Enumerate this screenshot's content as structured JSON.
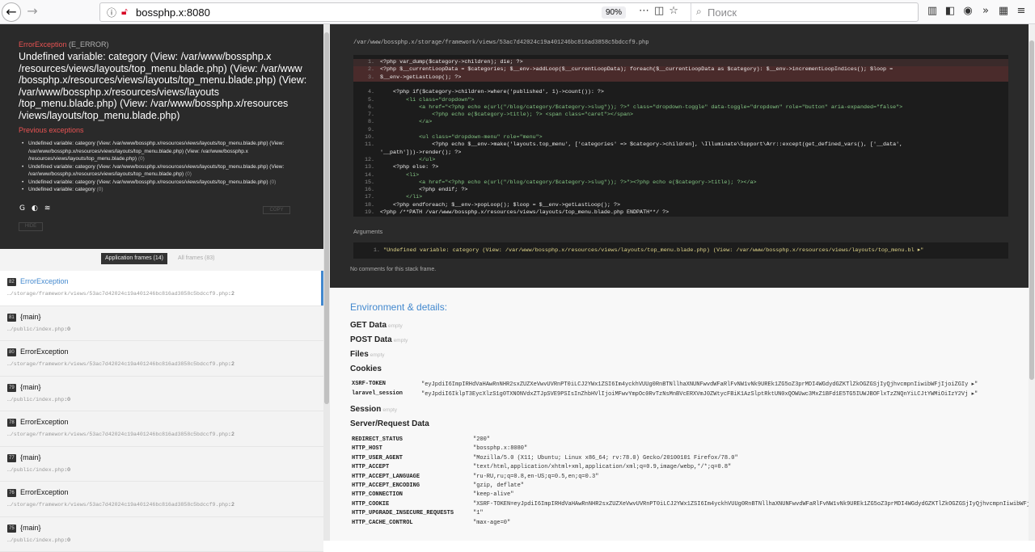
{
  "browser": {
    "url": "bossphp.x:8080",
    "zoom": "90%",
    "search_placeholder": "Поиск"
  },
  "exception": {
    "class": "ErrorException",
    "severity": "(E_ERROR)",
    "message": "Undefined variable: category (View: /var/www/bossphp.x /resources/views/layouts/top_menu.blade.php) (View: /var/www /bossphp.x/resources/views/layouts/top_menu.blade.php) (View: /var/www/bossphp.x/resources/views/layouts /top_menu.blade.php) (View: /var/www/bossphp.x/resources /views/layouts/top_menu.blade.php)",
    "previous_title": "Previous exceptions",
    "previous": [
      {
        "text": "Undefined variable: category (View: /var/www/bossphp.x/resources/views/layouts/top_menu.blade.php) (View: /var/www/bossphp.x/resources/views/layouts/top_menu.blade.php) (View: /var/www/bossphp.x /resources/views/layouts/top_menu.blade.php)",
        "n": "(0)"
      },
      {
        "text": "Undefined variable: category (View: /var/www/bossphp.x/resources/views/layouts/top_menu.blade.php) (View: /var/www/bossphp.x/resources/views/layouts/top_menu.blade.php)",
        "n": "(0)"
      },
      {
        "text": "Undefined variable: category (View: /var/www/bossphp.x/resources/views/layouts/top_menu.blade.php)",
        "n": "(0)"
      },
      {
        "text": "Undefined variable: category",
        "n": "(0)"
      }
    ],
    "copy_label": "COPY",
    "hide_label": "HIDE"
  },
  "frames_tabs": {
    "application": "Application frames (14)",
    "all": "All frames (83)"
  },
  "frames": [
    {
      "idx": "82",
      "cls": "ErrorException",
      "file": "…/storage/framework/views/53ac7d42024c19a401246bc816ad3858c5bdccf9.php",
      "line": "2"
    },
    {
      "idx": "81",
      "cls": "{main}",
      "file": "…/public/index.php",
      "line": "0"
    },
    {
      "idx": "80",
      "cls": "ErrorException",
      "file": "…/storage/framework/views/53ac7d42024c19a401246bc816ad3858c5bdccf9.php",
      "line": "2"
    },
    {
      "idx": "79",
      "cls": "{main}",
      "file": "…/public/index.php",
      "line": "0"
    },
    {
      "idx": "78",
      "cls": "ErrorException",
      "file": "…/storage/framework/views/53ac7d42024c19a401246bc816ad3858c5bdccf9.php",
      "line": "2"
    },
    {
      "idx": "77",
      "cls": "{main}",
      "file": "…/public/index.php",
      "line": "0"
    },
    {
      "idx": "76",
      "cls": "ErrorException",
      "file": "…/storage/framework/views/53ac7d42024c19a401246bc816ad3858c5bdccf9.php",
      "line": "2"
    },
    {
      "idx": "75",
      "cls": "{main}",
      "file": "…/public/index.php",
      "line": "0"
    }
  ],
  "code": {
    "file_path": "/var/www/bossphp.x/storage/framework/views/53ac7d42024c19a401246bc816ad3858c5bdccf9.php",
    "lines": [
      "<?php var_dump($category->children); die; ?>",
      "<?php $__currentLoopData = $categories; $__env->addLoop($__currentLoopData); foreach($__currentLoopData as $category): $__env->incrementLoopIndices(); $loop =",
      "$__env->getLastLoop(); ?>",
      "",
      "    <?php if($category->children->where('published', 1)->count()): ?>",
      "        <li class=\"dropdown\">",
      "            <a href=\"<?php echo e(url(\"/blog/category/$category->slug\")); ?>\" class=\"dropdown-toggle\" data-toggle=\"dropdown\" role=\"button\" aria-expanded=\"false\">",
      "                <?php echo e($category->title); ?> <span class=\"caret\"></span>",
      "            </a>",
      "",
      "            <ul class=\"dropdown-menu\" role=\"menu\">",
      "                <?php echo $__env->make('layouts.top_menu', ['categories' => $category->children], \\Illuminate\\Support\\Arr::except(get_defined_vars(), ['__data',",
      "'__path']))->render(); ?>",
      "            </ul>",
      "    <?php else: ?>",
      "        <li>",
      "            <a href=\"<?php echo e(url(\"/blog/category/$category->slug\")); ?>\"><?php echo e($category->title); ?></a>",
      "            <?php endif; ?>",
      "        </li>",
      "    <?php endforeach; $__env->popLoop(); $loop = $__env->getLastLoop(); ?>",
      "<?php /**PATH /var/www/bossphp.x/resources/views/layouts/top_menu.blade.php ENDPATH**/ ?>"
    ],
    "line_numbers": [
      "1.",
      "2.",
      "3.",
      "",
      "4.",
      "5.",
      "6.",
      "7.",
      "8.",
      "9.",
      "10.",
      "11.",
      "",
      "12.",
      "13.",
      "14.",
      "15.",
      "16.",
      "17.",
      "18.",
      "19.",
      "20."
    ],
    "arguments_title": "Arguments",
    "argument": "\"Undefined variable: category (View: /var/www/bossphp.x/resources/views/layouts/top_menu.blade.php) (View: /var/www/bossphp.x/resources/views/layouts/top_menu.bl ▸\"",
    "argument_n": "1.",
    "no_comments": "No comments for this stack frame."
  },
  "env": {
    "title": "Environment & details:",
    "get_data": "GET Data",
    "post_data": "POST Data",
    "files": "Files",
    "cookies": "Cookies",
    "session": "Session",
    "server": "Server/Request Data",
    "empty": "empty",
    "cookie_rows": [
      {
        "k": "XSRF-TOKEN",
        "v": "\"eyJpdiI6ImpIRHdVaHAwRnNHR2sxZUZXeVwvUVRnPT0iLCJ2YWx1ZSI6Im4yckhVUUg0RnBTNllhaXNUNFwvdWFaRlFvNW1vNk9UREk1ZG5oZ3prMDI4WGdydGZKTlZkOGZGSjIyQjhvcmpnIiwibWFjIjoiZGIy ▸\""
      },
      {
        "k": "laravel_session",
        "v": "\"eyJpdiI6IklpT3EycXlzS1g0TXNONVdxZTJpSVE9PSIsInZhbHVlIjoiMFwvYmpOc0RvTzNsMnBVcERXVmJ0ZWtycFBiK1AzSlptRktUN0xQOWUwc3MxZ1BFd1E5TG5IUWJBOFlxTzZNQnYiLCJtYWMiOiIzY2Vj ▸\""
      }
    ],
    "server_rows": [
      {
        "k": "REDIRECT_STATUS",
        "v": "\"200\""
      },
      {
        "k": "HTTP_HOST",
        "v": "\"bossphp.x:8080\""
      },
      {
        "k": "HTTP_USER_AGENT",
        "v": "\"Mozilla/5.0 (X11; Ubuntu; Linux x86_64; rv:78.0) Gecko/20100101 Firefox/78.0\""
      },
      {
        "k": "HTTP_ACCEPT",
        "v": "\"text/html,application/xhtml+xml,application/xml;q=0.9,image/webp,*/*;q=0.8\""
      },
      {
        "k": "HTTP_ACCEPT_LANGUAGE",
        "v": "\"ru-RU,ru;q=0.8,en-US;q=0.5,en;q=0.3\""
      },
      {
        "k": "HTTP_ACCEPT_ENCODING",
        "v": "\"gzip, deflate\""
      },
      {
        "k": "HTTP_CONNECTION",
        "v": "\"keep-alive\""
      },
      {
        "k": "HTTP_COOKIE",
        "v": "\"XSRF-TOKEN=eyJpdiI6ImpIRHdVaHAwRnNHR2sxZUZXeVwvUVRnPT0iLCJ2YWx1ZSI6Im4yckhVUUg0RnBTNllhaXNUNFwvdWFaRlFvNW1vNk9UREk1ZG5oZ3prMDI4WGdydGZKTlZkOGZGSjIyQjhvcmpnIiwibWFjIjoiZGIy"
      },
      {
        "k": "HTTP_UPGRADE_INSECURE_REQUESTS",
        "v": "\"1\""
      },
      {
        "k": "HTTP_CACHE_CONTROL",
        "v": "\"max-age=0\""
      }
    ]
  }
}
